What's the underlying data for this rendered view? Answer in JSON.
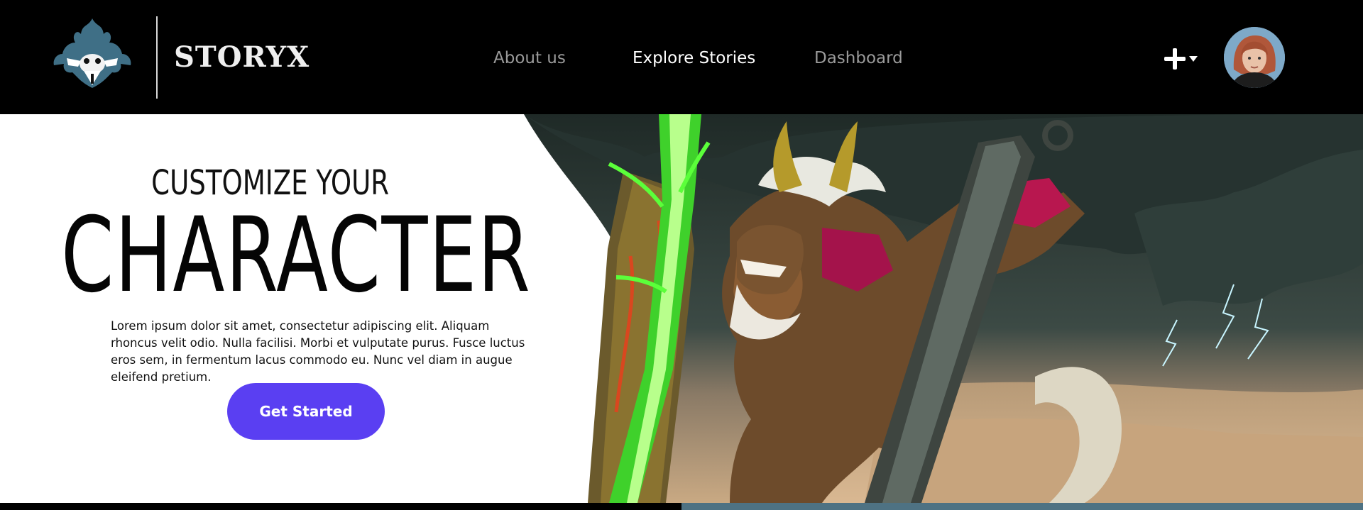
{
  "header": {
    "brand_name": "STORYX",
    "logo_icon": "horned-demon-skull-logo",
    "nav": [
      {
        "label": "About us",
        "active": false
      },
      {
        "label": "Explore Stories",
        "active": true
      },
      {
        "label": "Dashboard",
        "active": false
      }
    ],
    "create_icon": "plus-icon",
    "avatar_icon": "user-avatar"
  },
  "hero": {
    "subheading": "CUSTOMIZE YOUR",
    "heading": "CHARACTER",
    "body": "Lorem ipsum dolor sit amet, consectetur adipiscing elit. Aliquam rhoncus velit odio. Nulla facilisi. Morbi et vulputate purus. Fusce luctus eros sem, in fermentum lacus commodo eu. Nunc vel diam in augue eleifend pretium.",
    "cta_label": "Get Started",
    "art_icon": "horned-warrior-illustration"
  },
  "colors": {
    "header_bg": "#000000",
    "nav_active": "#ffffff",
    "nav_inactive": "#9a9a9a",
    "cta_bg": "#5a3ff2",
    "accent_bar": "#4e7283",
    "glow_green": "#5bff3a"
  }
}
